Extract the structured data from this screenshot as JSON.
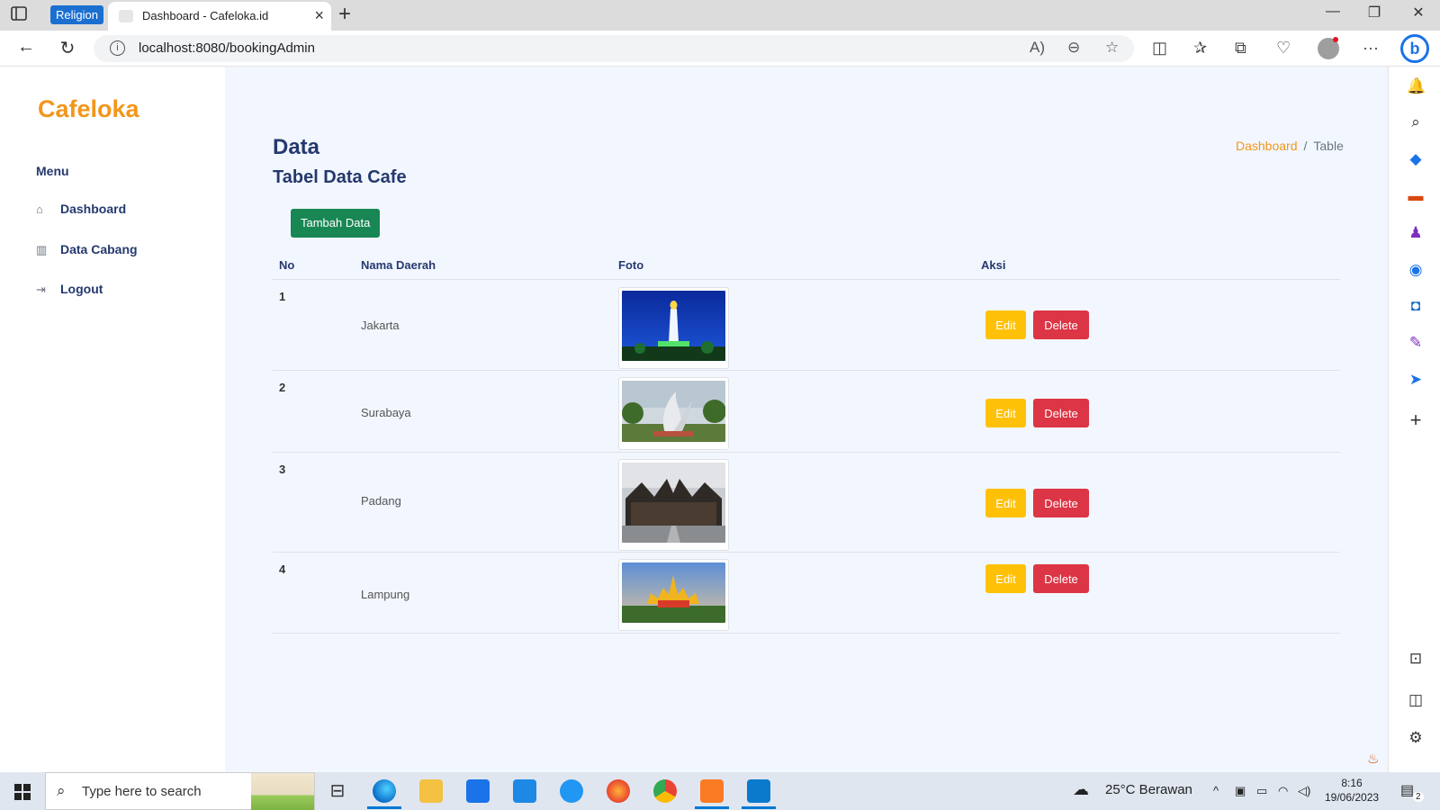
{
  "browser": {
    "tab_group": "Religion",
    "tab_title": "Dashboard - Cafeloka.id",
    "url": "localhost:8080/bookingAdmin"
  },
  "sidebar": {
    "brand": "Cafeloka",
    "menu_title": "Menu",
    "items": [
      {
        "label": "Dashboard",
        "icon": "home-icon"
      },
      {
        "label": "Data Cabang",
        "icon": "building-icon"
      },
      {
        "label": "Logout",
        "icon": "logout-icon"
      }
    ]
  },
  "header": {
    "title": "Data",
    "subtitle": "Tabel Data Cafe",
    "breadcrumb": {
      "link": "Dashboard",
      "separator": "/",
      "current": "Table"
    }
  },
  "actions": {
    "add_label": "Tambah Data"
  },
  "table": {
    "columns": [
      "No",
      "Nama Daerah",
      "Foto",
      "Aksi"
    ],
    "rows": [
      {
        "no": "1",
        "name": "Jakarta",
        "photo": "monas-monument-night"
      },
      {
        "no": "2",
        "name": "Surabaya",
        "photo": "suro-boyo-statue"
      },
      {
        "no": "3",
        "name": "Padang",
        "photo": "rumah-gadang"
      },
      {
        "no": "4",
        "name": "Lampung",
        "photo": "siger-tower"
      }
    ],
    "edit_label": "Edit",
    "delete_label": "Delete"
  },
  "taskbar": {
    "search_placeholder": "Type here to search",
    "weather": "25°C  Berawan",
    "time": "8:16",
    "date": "19/06/2023",
    "notification_count": "2"
  },
  "colors": {
    "brand": "#f3961b",
    "primary_text": "#25396f",
    "add_button": "#198754",
    "edit_button": "#ffc107",
    "delete_button": "#dc3545",
    "page_bg": "#f2f7ff"
  }
}
